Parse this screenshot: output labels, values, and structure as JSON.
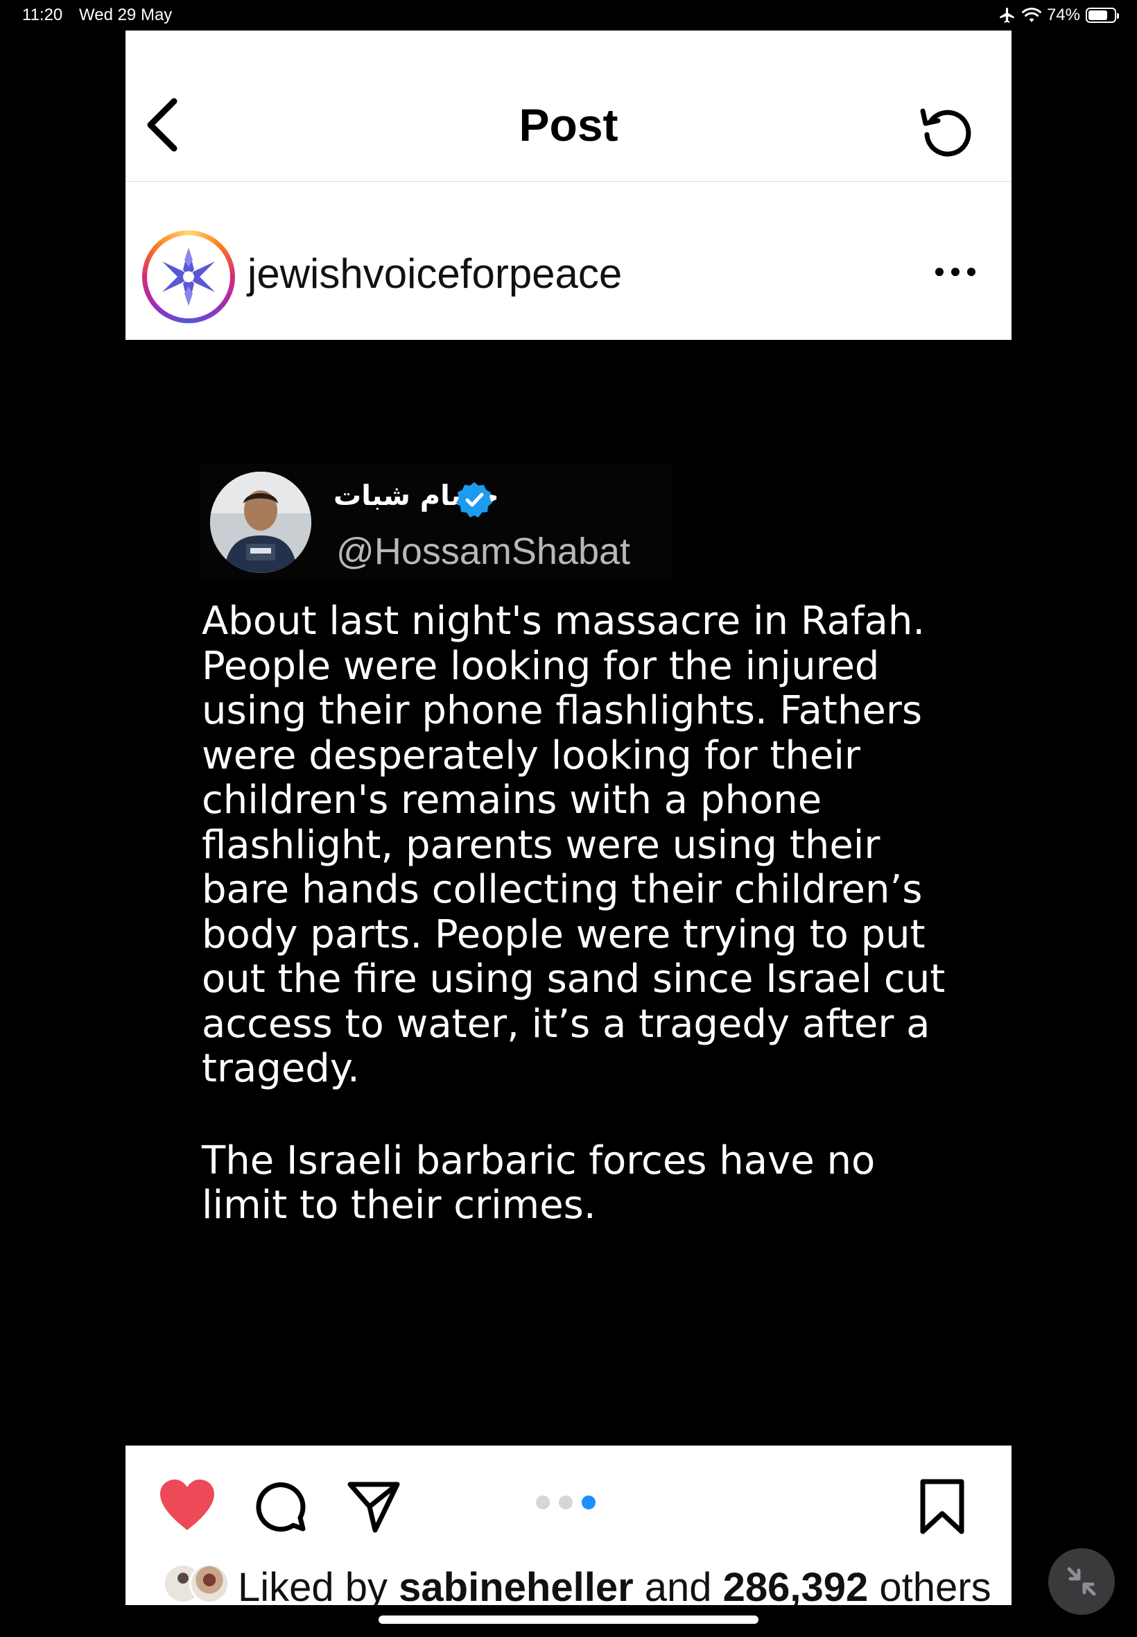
{
  "status_bar": {
    "time": "11:20",
    "date": "Wed 29 May",
    "battery": "74%",
    "battery_level": 0.74,
    "icons": [
      "airplane-icon",
      "wifi-icon",
      "battery-icon"
    ]
  },
  "header": {
    "title": "Post",
    "back_icon": "chevron-left-icon",
    "refresh_icon": "refresh-icon"
  },
  "post": {
    "username": "jewishvoiceforpeace",
    "avatar_icon": "star-logo-icon",
    "more_icon": "more-dots-icon",
    "tweet": {
      "display_name": "حسام شبات",
      "handle": "@HossamShabat",
      "verified": true,
      "paragraph1": "About last night's massacre in Rafah. People were looking for the injured using their phone flashlights. Fathers were desperately looking for their children's remains with a phone flashlight, parents were using their bare hands collecting their children’s body parts. People were trying to put out the fire using sand since Israel cut access to water, it’s a tragedy after a tragedy.",
      "paragraph2": "The Israeli barbaric forces have no limit to their crimes."
    }
  },
  "actions": {
    "liked": true,
    "like_icon": "heart-icon",
    "comment_icon": "comment-icon",
    "share_icon": "send-icon",
    "save_icon": "bookmark-icon",
    "carousel_total": 3,
    "carousel_active": 3
  },
  "likes": {
    "prefix": "Liked by ",
    "user": "sabineheller",
    "middle": " and ",
    "count": "286,392",
    "suffix": " others"
  },
  "colors": {
    "like_red": "#ed4956",
    "carousel_active": "#1f8fff",
    "verified_blue": "#1d9bf0",
    "background": "#000000"
  }
}
